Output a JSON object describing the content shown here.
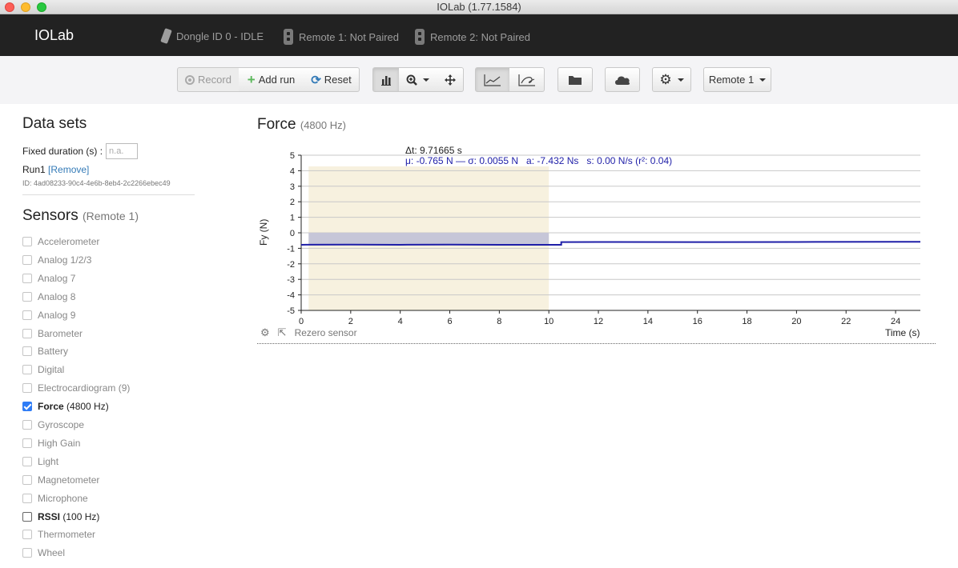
{
  "window": {
    "title": "IOLab (1.77.1584)"
  },
  "navbar": {
    "brand": "IOLab",
    "dongle": "Dongle ID 0 - IDLE",
    "remote1": "Remote 1: Not Paired",
    "remote2": "Remote 2: Not Paired"
  },
  "toolbar": {
    "record": "Record",
    "add_run": "Add run",
    "reset": "Reset",
    "remote_select": "Remote 1",
    "icons": [
      "bar-chart-icon",
      "zoom-icon",
      "move-icon",
      "line-chart-icon",
      "xy-chart-icon",
      "folder-icon",
      "cloud-icon",
      "gear-icon"
    ]
  },
  "datasets": {
    "heading": "Data sets",
    "fixed_duration_label": "Fixed duration (s) :",
    "fixed_duration_placeholder": "n.a.",
    "run_name": "Run1",
    "run_remove": "[Remove]",
    "run_id": "ID: 4ad08233-90c4-4e6b-8eb4-2c2266ebec49"
  },
  "sensors": {
    "heading": "Sensors",
    "remote": "(Remote 1)",
    "items": [
      {
        "name": "Accelerometer",
        "rate": "",
        "checked": false,
        "on": false
      },
      {
        "name": "Analog 1/2/3",
        "rate": "",
        "checked": false,
        "on": false
      },
      {
        "name": "Analog 7",
        "rate": "",
        "checked": false,
        "on": false
      },
      {
        "name": "Analog 8",
        "rate": "",
        "checked": false,
        "on": false
      },
      {
        "name": "Analog 9",
        "rate": "",
        "checked": false,
        "on": false
      },
      {
        "name": "Barometer",
        "rate": "",
        "checked": false,
        "on": false
      },
      {
        "name": "Battery",
        "rate": "",
        "checked": false,
        "on": false
      },
      {
        "name": "Digital",
        "rate": "",
        "checked": false,
        "on": false
      },
      {
        "name": "Electrocardiogram (9)",
        "rate": "",
        "checked": false,
        "on": false
      },
      {
        "name": "Force",
        "rate": "(4800 Hz)",
        "checked": true,
        "on": true
      },
      {
        "name": "Gyroscope",
        "rate": "",
        "checked": false,
        "on": false
      },
      {
        "name": "High Gain",
        "rate": "",
        "checked": false,
        "on": false
      },
      {
        "name": "Light",
        "rate": "",
        "checked": false,
        "on": false
      },
      {
        "name": "Magnetometer",
        "rate": "",
        "checked": false,
        "on": false
      },
      {
        "name": "Microphone",
        "rate": "",
        "checked": false,
        "on": false
      },
      {
        "name": "RSSI",
        "rate": "(100 Hz)",
        "checked": false,
        "on": true
      },
      {
        "name": "Thermometer",
        "rate": "",
        "checked": false,
        "on": false
      },
      {
        "name": "Wheel",
        "rate": "",
        "checked": false,
        "on": false
      }
    ]
  },
  "chart": {
    "title": "Force",
    "rate": "(4800 Hz)",
    "delta_t": "Δt: 9.71665 s",
    "stats": "μ: -0.765 N — σ: 0.0055 N   a: -7.432 Ns   s: 0.00 N/s (r²: 0.04)",
    "rezero": "Rezero sensor",
    "xlabel": "Time (s)",
    "ylabel": "Fy (N)"
  },
  "chart_data": {
    "type": "line",
    "xlabel": "Time (s)",
    "ylabel": "Fy (N)",
    "xlim": [
      0,
      25
    ],
    "ylim": [
      -5,
      5
    ],
    "xticks": [
      0,
      2,
      4,
      6,
      8,
      10,
      12,
      14,
      16,
      18,
      20,
      22,
      24
    ],
    "yticks": [
      5,
      4,
      3,
      2,
      1,
      0,
      -1,
      -2,
      -3,
      -4,
      -5
    ],
    "selection": {
      "x_start": 0.3,
      "x_end": 10.0
    },
    "series": [
      {
        "name": "",
        "color": "#1f1fa8",
        "x": [
          0,
          2,
          4,
          6,
          8,
          10,
          10.5,
          10.5,
          12,
          16,
          20,
          24,
          25
        ],
        "y": [
          -0.77,
          -0.76,
          -0.77,
          -0.76,
          -0.77,
          -0.77,
          -0.77,
          -0.6,
          -0.59,
          -0.6,
          -0.59,
          -0.58,
          -0.58
        ]
      }
    ],
    "grid": true
  }
}
